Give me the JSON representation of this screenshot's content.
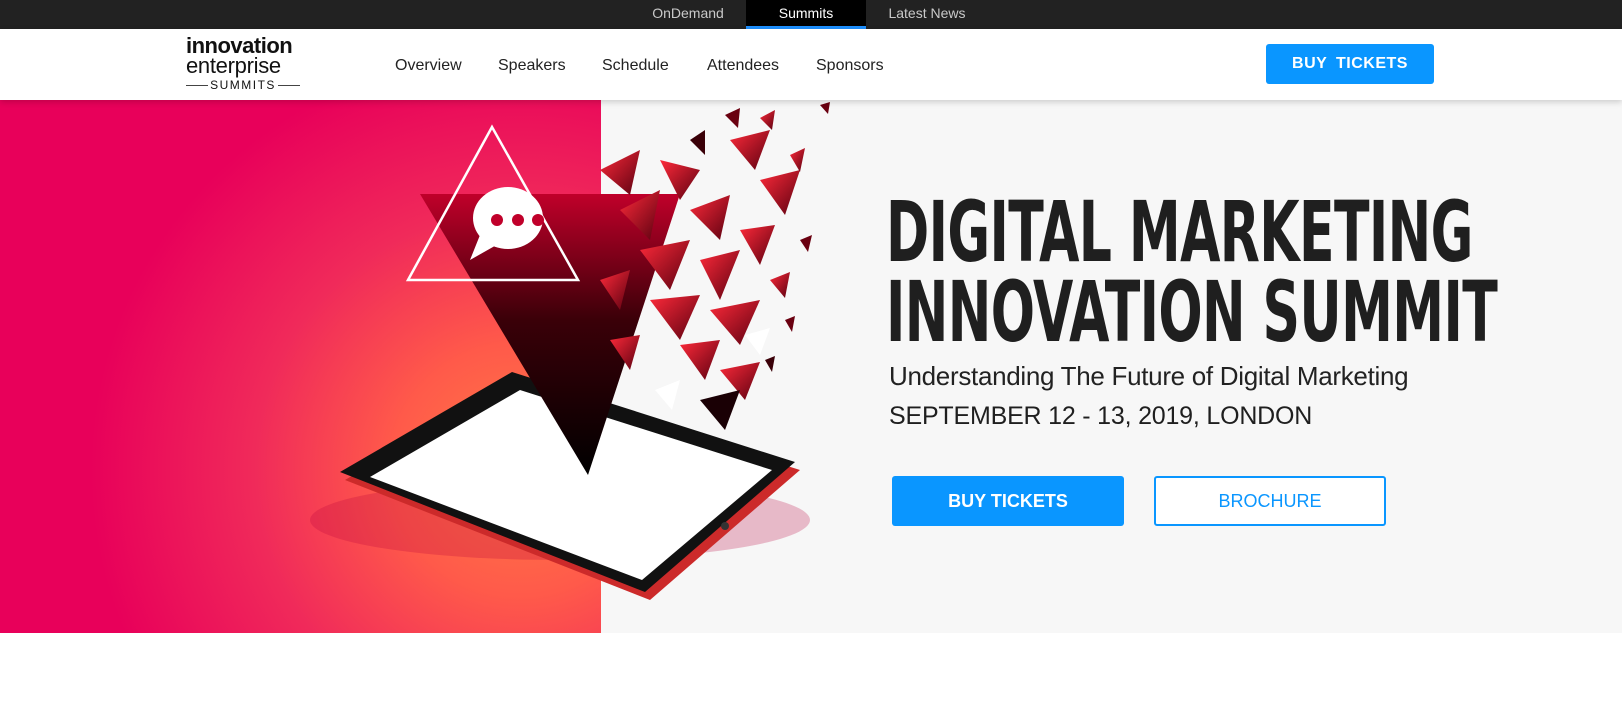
{
  "topbar": {
    "tabs": [
      {
        "label": "OnDemand",
        "active": false
      },
      {
        "label": "Summits",
        "active": true
      },
      {
        "label": "Latest News",
        "active": false
      }
    ]
  },
  "header": {
    "logo": {
      "line1": "innovation",
      "line2": "enterprise",
      "line3": "SUMMITS"
    },
    "nav": [
      "Overview",
      "Speakers",
      "Schedule",
      "Attendees",
      "Sponsors"
    ],
    "buy_label": "BUY TICKETS"
  },
  "hero": {
    "title_line1": "DIGITAL MARKETING",
    "title_line2": "INNOVATION SUMMIT",
    "subtitle": "Understanding The Future of Digital Marketing",
    "date": "SEPTEMBER 12 - 13, 2019, LONDON",
    "buy_label": "BUY TICKETS",
    "brochure_label": "BROCHURE"
  },
  "colors": {
    "accent": "#0a96ff",
    "topbar": "#222222",
    "hero_magenta": "#e8005a",
    "hero_orange": "#ff7a45"
  }
}
